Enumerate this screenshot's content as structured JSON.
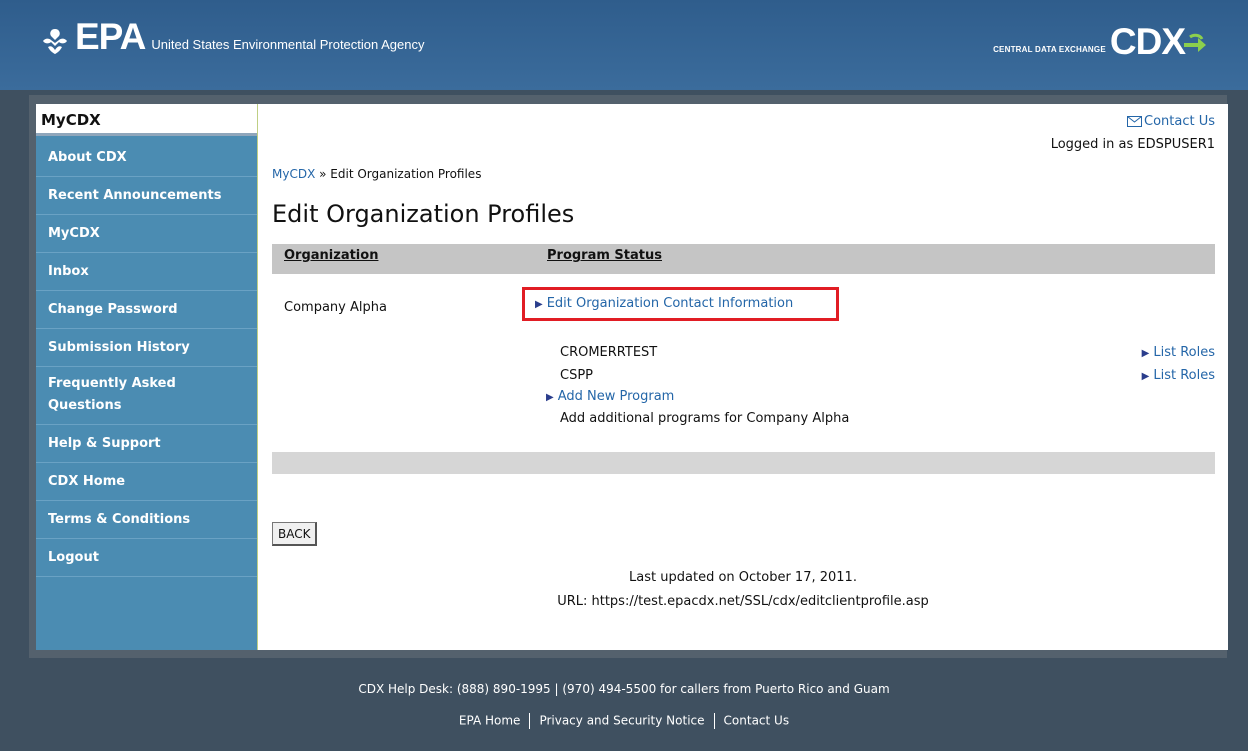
{
  "header": {
    "epa_logo_text": "EPA",
    "agency_name": "United States Environmental Protection Agency",
    "cdx_tagline": "CENTRAL DATA EXCHANGE",
    "cdx_logo_text": "CDX"
  },
  "sidebar": {
    "title": "MyCDX",
    "items": [
      {
        "label": "About CDX"
      },
      {
        "label": "Recent Announcements"
      },
      {
        "label": "MyCDX"
      },
      {
        "label": "Inbox"
      },
      {
        "label": "Change Password"
      },
      {
        "label": "Submission History"
      },
      {
        "label": "Frequently Asked Questions"
      },
      {
        "label": "Help & Support"
      },
      {
        "label": "CDX Home"
      },
      {
        "label": "Terms & Conditions"
      },
      {
        "label": "Logout"
      }
    ]
  },
  "main": {
    "contact_link": "Contact Us",
    "logged_in": "Logged in as EDSPUSER1",
    "breadcrumb": {
      "root": "MyCDX",
      "separator": "»",
      "current": "Edit Organization Profiles"
    },
    "title": "Edit Organization Profiles",
    "table": {
      "col_org": "Organization",
      "col_status": "Program Status"
    },
    "org_name": "Company Alpha",
    "edit_link": "Edit Organization Contact Information",
    "programs": [
      {
        "name": "CROMERRTEST",
        "action": "List Roles"
      },
      {
        "name": "CSPP",
        "action": "List Roles"
      }
    ],
    "add_program": "Add New Program",
    "add_desc": "Add additional programs for Company Alpha",
    "back_button": "BACK",
    "last_updated": "Last updated on October 17, 2011.",
    "url": "URL: https://test.epacdx.net/SSL/cdx/editclientprofile.asp"
  },
  "footer": {
    "helpdesk": "CDX Help Desk: (888) 890-1995 | (970) 494-5500 for callers from Puerto Rico and Guam",
    "links": [
      "EPA Home",
      "Privacy and Security Notice",
      "Contact Us"
    ]
  },
  "colors": {
    "accent_red": "#e11d24",
    "link_blue": "#2466a8",
    "sidebar_blue": "#4b8cb2",
    "header_blue": "#2f5d8c"
  }
}
